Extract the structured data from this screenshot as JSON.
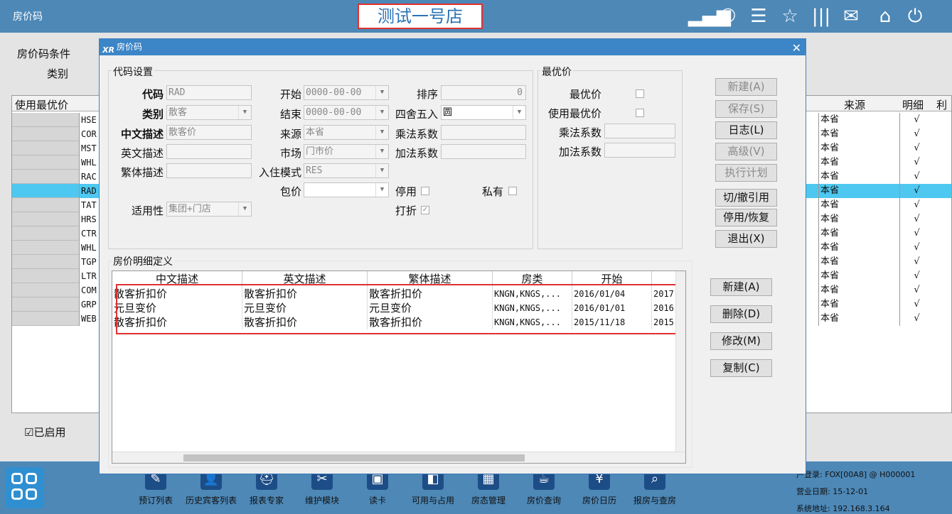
{
  "app": {
    "title": "房价码",
    "store_name": "测试一号店"
  },
  "topbar_icons": [
    "signal-icon",
    "phone-icon",
    "menu-icon",
    "star-icon",
    "bars-icon",
    "mail-icon",
    "home-icon",
    "power-icon"
  ],
  "background": {
    "condition_label": "房价码条件",
    "type_label": "类别",
    "col_use_best": "使用最优价",
    "col_source": "来源",
    "col_detail": "明细",
    "col_more": "利",
    "rows": [
      {
        "code": "HSE",
        "source": "本省",
        "detail": "√"
      },
      {
        "code": "COR",
        "source": "本省",
        "detail": "√"
      },
      {
        "code": "MST",
        "source": "本省",
        "detail": "√"
      },
      {
        "code": "WHL",
        "source": "本省",
        "detail": "√"
      },
      {
        "code": "RAC",
        "source": "本省",
        "detail": "√"
      },
      {
        "code": "RAD",
        "source": "本省",
        "detail": "√"
      },
      {
        "code": "TAT",
        "source": "本省",
        "detail": "√"
      },
      {
        "code": "HRS",
        "source": "本省",
        "detail": "√"
      },
      {
        "code": "CTR",
        "source": "本省",
        "detail": "√"
      },
      {
        "code": "WHL",
        "source": "本省",
        "detail": "√"
      },
      {
        "code": "TGP",
        "source": "本省",
        "detail": "√"
      },
      {
        "code": "LTR",
        "source": "本省",
        "detail": "√"
      },
      {
        "code": "COM",
        "source": "本省",
        "detail": "√"
      },
      {
        "code": "GRP",
        "source": "本省",
        "detail": "√"
      },
      {
        "code": "WEB",
        "source": "本省",
        "detail": "√"
      }
    ],
    "enabled_label": "已启用"
  },
  "dialog": {
    "title": "房价码",
    "code_settings": {
      "group_label": "代码设置",
      "code_label": "代码",
      "code_value": "RAD",
      "type_label": "类别",
      "type_value": "散客",
      "cn_desc_label": "中文描述",
      "cn_desc_value": "散客价",
      "en_desc_label": "英文描述",
      "en_desc_value": "",
      "tw_desc_label": "繁体描述",
      "tw_desc_value": "",
      "start_label": "开始",
      "start_value": "0000-00-00",
      "end_label": "结束",
      "end_value": "0000-00-00",
      "source_label": "来源",
      "source_value": "本省",
      "market_label": "市场",
      "market_value": "门市价",
      "checkin_label": "入住模式",
      "checkin_value": "RES",
      "package_label": "包价",
      "package_value": "",
      "applicability_label": "适用性",
      "applicability_value": "集团+门店",
      "sort_label": "排序",
      "sort_value": "0",
      "rounding_label": "四舍五入",
      "rounding_value": "圆",
      "mult_label": "乘法系数",
      "mult_value": "",
      "add_label": "加法系数",
      "add_value": "",
      "disable_label": "停用",
      "private_label": "私有",
      "discount_label": "打折"
    },
    "best_price": {
      "group_label": "最优价",
      "best_label": "最优价",
      "use_best_label": "使用最优价",
      "mult_label": "乘法系数",
      "mult_value": "",
      "add_label": "加法系数",
      "add_value": ""
    },
    "buttons_top": [
      "新建(A)",
      "保存(S)",
      "日志(L)",
      "高级(V)",
      "执行计划",
      "切/撤引用",
      "停用/恢复",
      "退出(X)"
    ],
    "detail": {
      "group_label": "房价明细定义",
      "headers": [
        "中文描述",
        "英文描述",
        "繁体描述",
        "房类",
        "开始"
      ],
      "rows": [
        {
          "cn": "散客折扣价",
          "en": "散客折扣价",
          "tw": "散客折扣价",
          "room": "KNGN,KNGS,...",
          "start": "2016/01/04",
          "end": "2017"
        },
        {
          "cn": "元旦变价",
          "en": "元旦变价",
          "tw": "元旦变价",
          "room": "KNGN,KNGS,...",
          "start": "2016/01/01",
          "end": "2016"
        },
        {
          "cn": "散客折扣价",
          "en": "散客折扣价",
          "tw": "散客折扣价",
          "room": "KNGN,KNGS,...",
          "start": "2015/11/18",
          "end": "2015"
        }
      ]
    },
    "buttons_detail": [
      "新建(A)",
      "删除(D)",
      "修改(M)",
      "复制(C)"
    ]
  },
  "bottom": {
    "modules": [
      {
        "label": "预订列表",
        "icon": "booking-list-icon"
      },
      {
        "label": "历史宾客列表",
        "icon": "guest-history-icon"
      },
      {
        "label": "报表专家",
        "icon": "report-expert-icon"
      },
      {
        "label": "维护模块",
        "icon": "maintenance-icon"
      },
      {
        "label": "读卡",
        "icon": "card-reader-icon"
      },
      {
        "label": "可用与占用",
        "icon": "availability-icon"
      },
      {
        "label": "房态管理",
        "icon": "room-status-icon"
      },
      {
        "label": "房价查询",
        "icon": "rate-query-icon"
      },
      {
        "label": "房价日历",
        "icon": "rate-calendar-icon"
      },
      {
        "label": "报房与查房",
        "icon": "room-check-icon"
      }
    ],
    "user_login": "户登录: FOX[00A8] @ H000001",
    "business_date": "营业日期: 15-12-01",
    "system_address": "系统地址: 192.168.3.164"
  }
}
